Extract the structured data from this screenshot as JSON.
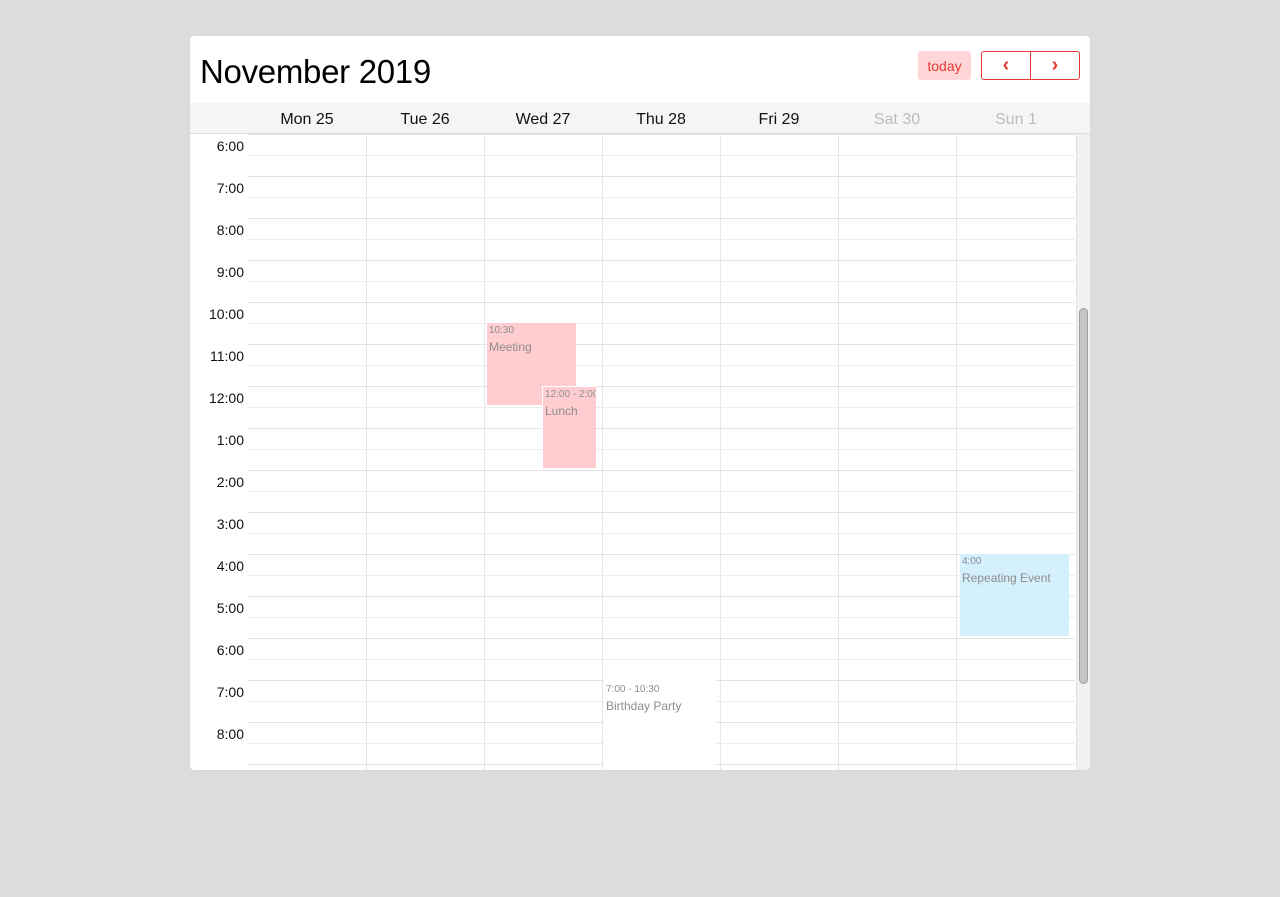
{
  "header": {
    "title": "November 2019",
    "today_label": "today",
    "prev_icon": "‹",
    "next_icon": "›"
  },
  "days": [
    {
      "label": "Mon 25",
      "weekend": false
    },
    {
      "label": "Tue 26",
      "weekend": false
    },
    {
      "label": "Wed 27",
      "weekend": false
    },
    {
      "label": "Thu 28",
      "weekend": false
    },
    {
      "label": "Fri 29",
      "weekend": false
    },
    {
      "label": "Sat 30",
      "weekend": true
    },
    {
      "label": "Sun 1",
      "weekend": true
    }
  ],
  "times": [
    "6:00",
    "7:00",
    "8:00",
    "9:00",
    "10:00",
    "11:00",
    "12:00",
    "1:00",
    "2:00",
    "3:00",
    "4:00",
    "5:00",
    "6:00",
    "7:00",
    "8:00"
  ],
  "events": [
    {
      "time": "10:30",
      "title": "Meeting",
      "day": "Wed 27"
    },
    {
      "time": "12:00 - 2:00",
      "title": "Lunch",
      "day": "Wed 27"
    },
    {
      "time": "4:00",
      "title": "Repeating Event",
      "day": "Sun 1"
    },
    {
      "time": "7:00 - 10:30",
      "title": "Birthday Party",
      "day": "Thu 28"
    }
  ],
  "colors": {
    "accent": "#e53935",
    "today_bg": "#ffd6d8",
    "event_pink": "#ffcdd0",
    "event_blue": "#d4f0fd",
    "weekend_text": "#bdbdbd",
    "page_bg": "#dcdcdc"
  }
}
